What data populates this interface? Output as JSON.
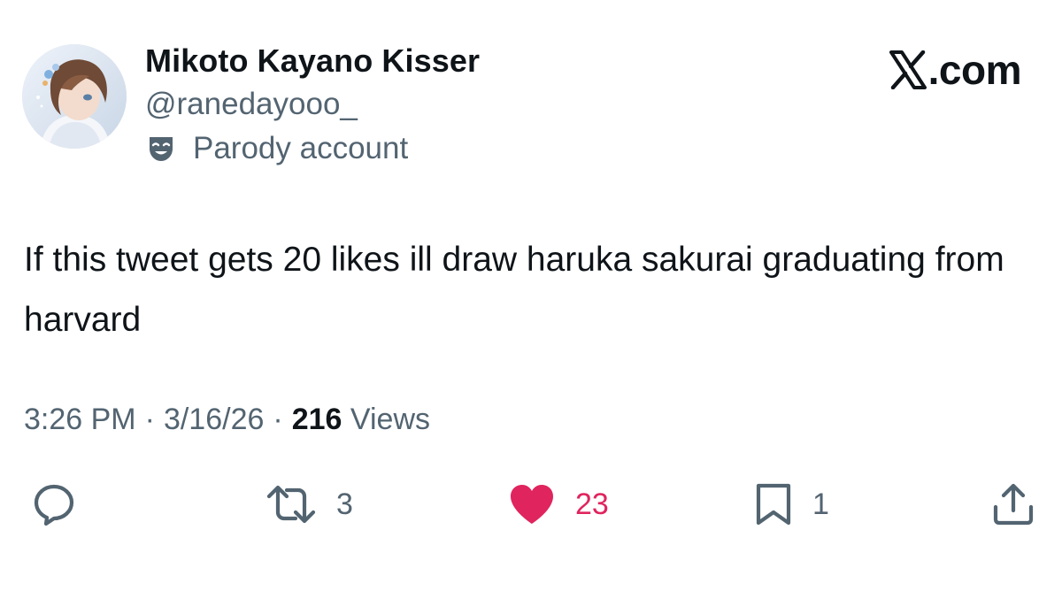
{
  "author": {
    "display_name": "Mikoto Kayano Kisser",
    "handle": "@ranedayooo_",
    "account_label": "Parody account",
    "account_label_icon": "parody-mask-icon"
  },
  "brand": {
    "logo_icon": "x-logo-icon",
    "text": ".com"
  },
  "tweet": {
    "text": "If this tweet gets 20 likes ill draw haruka sakurai graduating from harvard",
    "time": "3:26 PM",
    "separator": "·",
    "date": "3/16/26",
    "views_count": "216",
    "views_label": "Views"
  },
  "actions": {
    "reply": {
      "icon": "reply-icon",
      "count": ""
    },
    "retweet": {
      "icon": "retweet-icon",
      "count": "3"
    },
    "like": {
      "icon": "heart-icon",
      "count": "23",
      "active": true
    },
    "bookmark": {
      "icon": "bookmark-icon",
      "count": "1"
    },
    "share": {
      "icon": "share-icon",
      "count": ""
    }
  },
  "colors": {
    "text_primary": "#0f1419",
    "text_secondary": "#536471",
    "like_active": "#e0245e"
  }
}
